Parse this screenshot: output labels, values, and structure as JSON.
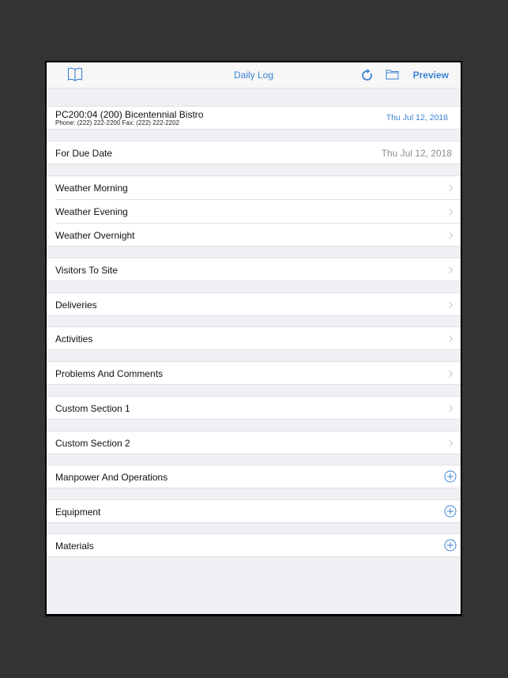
{
  "navbar": {
    "title": "Daily Log",
    "left_icon": "book-icon",
    "right_icons": [
      "refresh-icon",
      "folder-icon"
    ],
    "preview_label": "Preview",
    "accent_color": "#3c82d6"
  },
  "project": {
    "name": "PC200:04 (200) Bicentennial Bistro",
    "contact": "Phone: (222) 222-2200 Fax: (222) 222-2202",
    "date": "Thu Jul 12, 2018"
  },
  "due": {
    "label": "For Due Date",
    "value": "Thu Jul 12, 2018"
  },
  "weather": [
    {
      "label": "Weather Morning"
    },
    {
      "label": "Weather Evening"
    },
    {
      "label": "Weather Overnight"
    }
  ],
  "sections": [
    {
      "label": "Visitors To Site",
      "accessory": "chevron"
    },
    {
      "label": "Deliveries",
      "accessory": "chevron"
    },
    {
      "label": "Activities",
      "accessory": "chevron"
    },
    {
      "label": "Problems And Comments",
      "accessory": "chevron"
    },
    {
      "label": "Custom Section 1",
      "accessory": "chevron"
    },
    {
      "label": "Custom Section 2",
      "accessory": "chevron"
    },
    {
      "label": "Manpower And Operations",
      "accessory": "plus"
    },
    {
      "label": "Equipment",
      "accessory": "plus"
    },
    {
      "label": "Materials",
      "accessory": "plus"
    }
  ]
}
